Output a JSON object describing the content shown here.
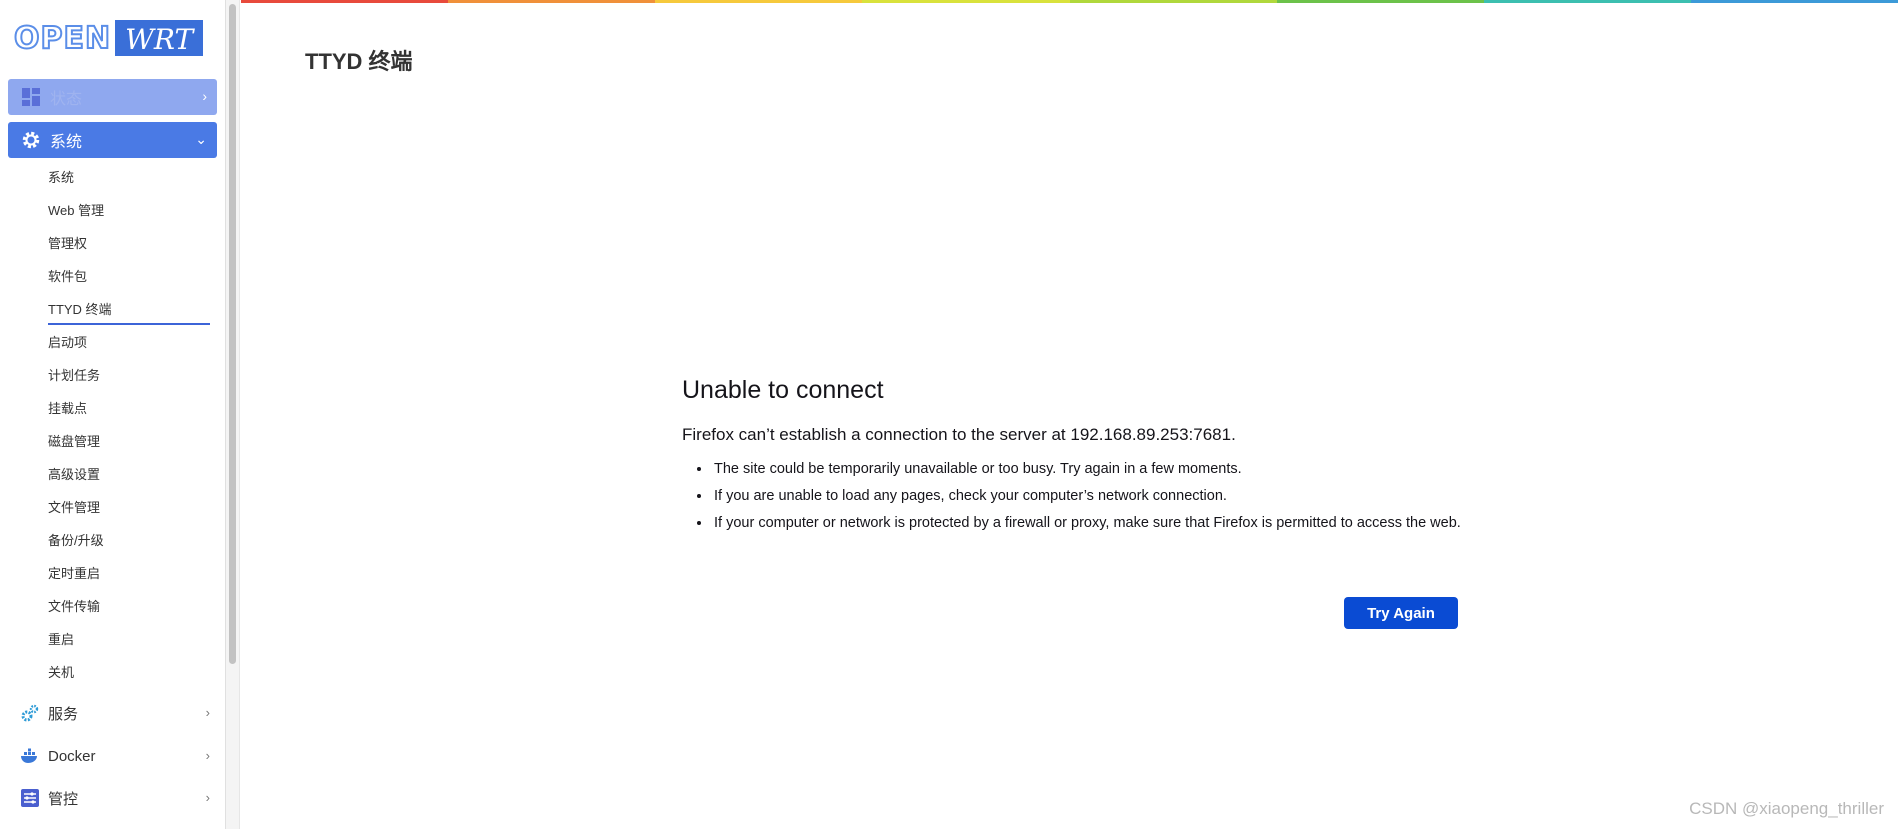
{
  "logo": {
    "part1": "OPEN",
    "part2": "WRT"
  },
  "sidebar": {
    "status_label": "状态",
    "system_label": "系统",
    "system_items": [
      "系统",
      "Web 管理",
      "管理权",
      "软件包",
      "TTYD 终端",
      "启动项",
      "计划任务",
      "挂载点",
      "磁盘管理",
      "高级设置",
      "文件管理",
      "备份/升级",
      "定时重启",
      "文件传输",
      "重启",
      "关机"
    ],
    "active_item": "TTYD 终端",
    "services_label": "服务",
    "docker_label": "Docker",
    "control_label": "管控"
  },
  "rainbow_colors": [
    "#e84a3c",
    "#f0903a",
    "#f6c93c",
    "#d9e23c",
    "#b0d83c",
    "#6cc24a",
    "#3cbfb0",
    "#3c9ad8"
  ],
  "main": {
    "page_title": "TTYD 终端",
    "error": {
      "title": "Unable to connect",
      "description": "Firefox can’t establish a connection to the server at 192.168.89.253:7681.",
      "items": [
        "The site could be temporarily unavailable or too busy. Try again in a few moments.",
        "If you are unable to load any pages, check your computer’s network connection.",
        "If your computer or network is protected by a firewall or proxy, make sure that Firefox is permitted to access the web."
      ],
      "button_label": "Try Again"
    }
  },
  "watermark": "CSDN @xiaopeng_thriller"
}
